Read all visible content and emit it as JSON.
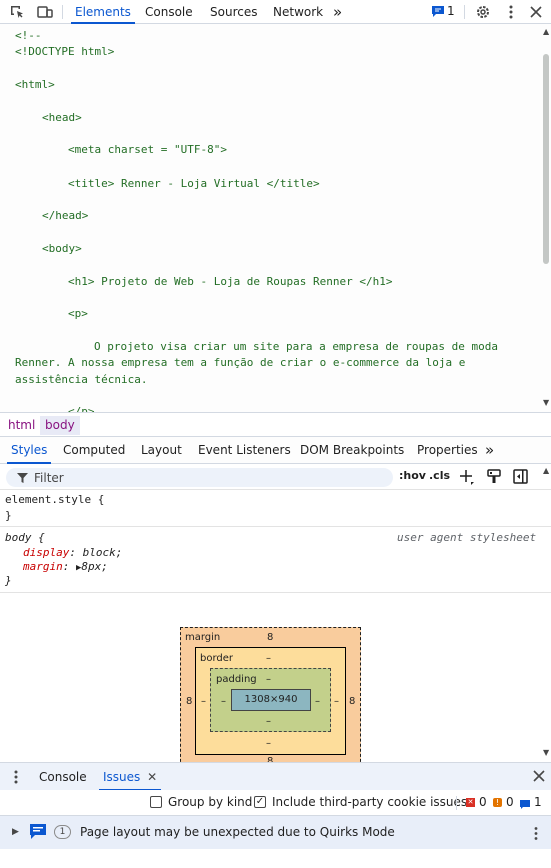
{
  "toolbar": {
    "icons": [
      "inspect-element-icon",
      "device-toolbar-icon",
      "settings-gear-icon",
      "more-vertical-icon",
      "close-icon"
    ],
    "tabs": [
      "Elements",
      "Console",
      "Sources",
      "Network"
    ],
    "more_tabs": "»",
    "issues_count": "1"
  },
  "elements": {
    "lines": [
      {
        "text": "<!--"
      },
      {
        "text": "<!DOCTYPE html>"
      },
      {
        "text": "<html>"
      },
      {
        "text": "<head>"
      },
      {
        "text": "<meta charset = \"UTF-8\">"
      },
      {
        "text": "<title> Renner - Loja Virtual </title>"
      },
      {
        "text": "</head>"
      },
      {
        "text": "<body>"
      },
      {
        "text": "<h1> Projeto de Web - Loja de Roupas Renner </h1>"
      },
      {
        "text": "<p>"
      },
      {
        "text": "O projeto visa criar um site para a empresa de roupas de moda"
      },
      {
        "text": "Renner. A nossa empresa tem a função de criar o e-commerce da loja e"
      },
      {
        "text": "assistência técnica."
      },
      {
        "text": "</p>"
      }
    ]
  },
  "breadcrumb": [
    "html",
    "body"
  ],
  "styles": {
    "tabs": [
      "Styles",
      "Computed",
      "Layout",
      "Event Listeners",
      "DOM Breakpoints",
      "Properties"
    ],
    "more_tabs": "»",
    "filter_placeholder": "Filter",
    "hov": ":hov",
    "cls": ".cls",
    "rules": {
      "element_style": {
        "selector": "element.style {",
        "close": "}"
      },
      "body": {
        "selector": "body {",
        "source": "user agent stylesheet",
        "props": [
          {
            "name": "display",
            "value": "block;"
          },
          {
            "name": "margin",
            "value": "8px;"
          }
        ],
        "close": "}"
      }
    }
  },
  "box_model": {
    "margin_label": "margin",
    "margin_top": "8",
    "margin_left": "8",
    "margin_right": "8",
    "margin_bottom": "8",
    "border_label": "border",
    "border_top": "–",
    "border_left": "–",
    "border_right": "–",
    "border_bottom": "–",
    "padding_label": "padding",
    "padding_top": "–",
    "padding_left": "–",
    "padding_right": "–",
    "padding_bottom": "–",
    "content": "1308×940"
  },
  "drawer": {
    "tabs": [
      "Console",
      "Issues"
    ],
    "group_by_kind": "Group by kind",
    "third_party": "Include third-party cookie issues",
    "counts": {
      "errors": "0",
      "warnings": "0",
      "info": "1"
    },
    "issue": {
      "count": "1",
      "text": "Page layout may be unexpected due to Quirks Mode"
    }
  },
  "colors": {
    "accent": "#0b57d0",
    "tag": "#881280",
    "text_node": "#1e7e34",
    "prop": "#c80000"
  }
}
